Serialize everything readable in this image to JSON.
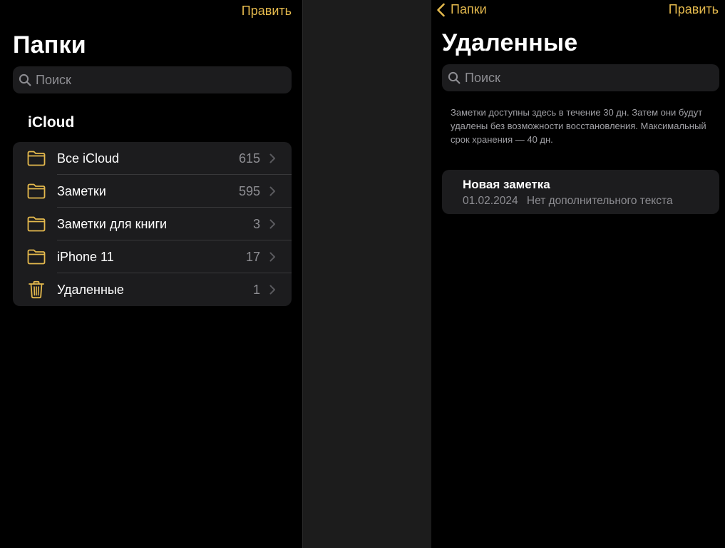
{
  "colors": {
    "accent": "#e4b94d",
    "background": "#000000",
    "card": "#1c1c1e",
    "secondary_text": "#8e8e93",
    "separator": "#38383a"
  },
  "folders_pane": {
    "edit_label": "Править",
    "title": "Папки",
    "search_placeholder": "Поиск",
    "section_header": "iCloud",
    "folders": [
      {
        "icon": "folder-icon",
        "label": "Все iCloud",
        "count": "615"
      },
      {
        "icon": "folder-icon",
        "label": "Заметки",
        "count": "595"
      },
      {
        "icon": "folder-icon",
        "label": "Заметки для книги",
        "count": "3"
      },
      {
        "icon": "folder-icon",
        "label": "iPhone 11",
        "count": "17"
      },
      {
        "icon": "trash-icon",
        "label": "Удаленные",
        "count": "1"
      }
    ]
  },
  "deleted_pane": {
    "back_label": "Папки",
    "edit_label": "Править",
    "title": "Удаленные",
    "search_placeholder": "Поиск",
    "info_text": "Заметки доступны здесь в течение 30 дн. Затем они будут удалены без возможности восстановления. Максимальный срок хранения — 40 дн.",
    "notes": [
      {
        "title": "Новая заметка",
        "date": "01.02.2024",
        "preview": "Нет дополнительного текста"
      }
    ]
  }
}
